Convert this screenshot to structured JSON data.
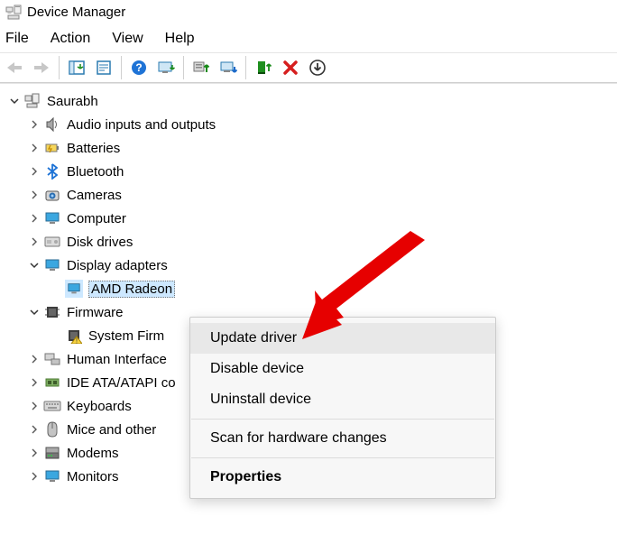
{
  "titlebar": {
    "title": "Device Manager"
  },
  "menubar": {
    "file": "File",
    "action": "Action",
    "view": "View",
    "help": "Help"
  },
  "tree": {
    "root": {
      "label": "Saurabh"
    },
    "items": [
      {
        "label": "Audio inputs and outputs"
      },
      {
        "label": "Batteries"
      },
      {
        "label": "Bluetooth"
      },
      {
        "label": "Cameras"
      },
      {
        "label": "Computer"
      },
      {
        "label": "Disk drives"
      },
      {
        "label": "Display adapters"
      },
      {
        "label": "Firmware"
      },
      {
        "label": "Human Interface"
      },
      {
        "label": "IDE ATA/ATAPI co"
      },
      {
        "label": "Keyboards"
      },
      {
        "label": "Mice and other"
      },
      {
        "label": "Modems"
      },
      {
        "label": "Monitors"
      }
    ],
    "display_child": {
      "label": "AMD Radeon"
    },
    "firmware_child": {
      "label": "System Firm"
    }
  },
  "context_menu": {
    "update": "Update driver",
    "disable": "Disable device",
    "uninstall": "Uninstall device",
    "scan": "Scan for hardware changes",
    "properties": "Properties"
  }
}
